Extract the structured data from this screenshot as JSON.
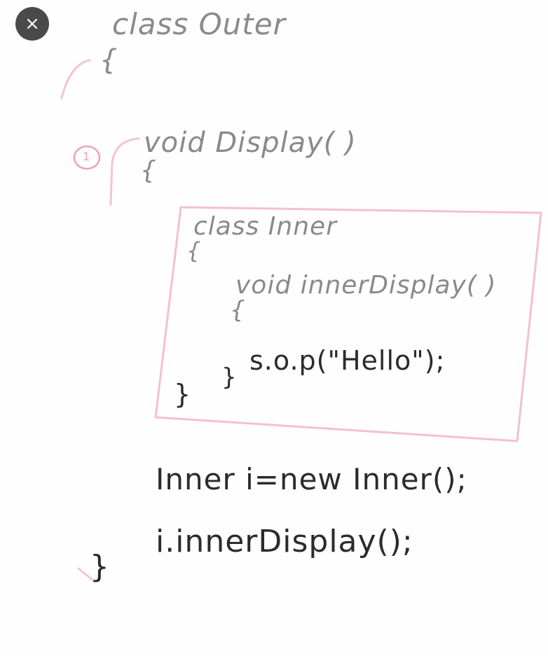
{
  "toolbar": {
    "close_icon": "close-icon"
  },
  "board": {
    "step_marker": "1",
    "lines": {
      "outer_class": "class Outer",
      "outer_open": "{",
      "display_decl": "void Display( )",
      "display_open": "{",
      "inner_class": "class Inner",
      "inner_open": "{",
      "inner_display_decl": "void innerDisplay( )",
      "inner_display_open": "{",
      "sop_stmt": "s.o.p(\"Hello\");",
      "inner_display_close": "}",
      "inner_close": "}",
      "instantiate_stmt": "Inner i=new Inner();",
      "call_stmt": "i.innerDisplay();",
      "final_close": "}"
    },
    "colors": {
      "ink": "#2b2b2b",
      "faint_ink": "#8a8a8a",
      "pink_marker": "#f0a0b8",
      "close_button_bg": "#4a4a4a"
    }
  }
}
